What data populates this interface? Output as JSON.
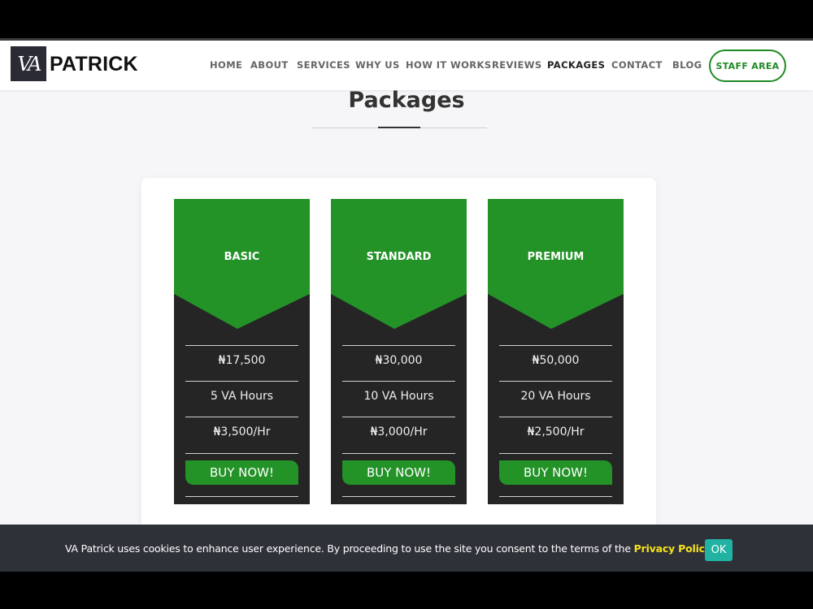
{
  "brand": {
    "logo_mark": "VA",
    "name": "PATRICK"
  },
  "nav": {
    "items": [
      {
        "label": "HOME"
      },
      {
        "label": "ABOUT"
      },
      {
        "label": "SERVICES"
      },
      {
        "label": "WHY US"
      },
      {
        "label": "HOW IT WORKS"
      },
      {
        "label": "REVIEWS"
      },
      {
        "label": "PACKAGES",
        "active": true
      },
      {
        "label": "CONTACT"
      },
      {
        "label": "BLOG"
      }
    ],
    "staff_button": "STAFF AREA"
  },
  "page": {
    "title": "Packages"
  },
  "plans": [
    {
      "name": "BASIC",
      "price": "₦17,500",
      "hours": "5 VA Hours",
      "rate": "₦3,500/Hr",
      "button": "BUY NOW!"
    },
    {
      "name": "STANDARD",
      "price": "₦30,000",
      "hours": "10 VA Hours",
      "rate": "₦3,000/Hr",
      "button": "BUY NOW!"
    },
    {
      "name": "PREMIUM",
      "price": "₦50,000",
      "hours": "20 VA Hours",
      "rate": "₦2,500/Hr",
      "button": "BUY NOW!"
    }
  ],
  "cookie": {
    "text": "VA Patrick uses cookies to enhance user experience. By proceeding to use the site you consent to the terms of the ",
    "link": "Privacy Policy",
    "end": ".",
    "ok": "OK"
  },
  "colors": {
    "accent_green": "#239227",
    "card_dark": "#252525",
    "cookie_bg": "#2f3139",
    "cookie_link": "#f5e21b",
    "ok_button": "#20b2a2"
  }
}
